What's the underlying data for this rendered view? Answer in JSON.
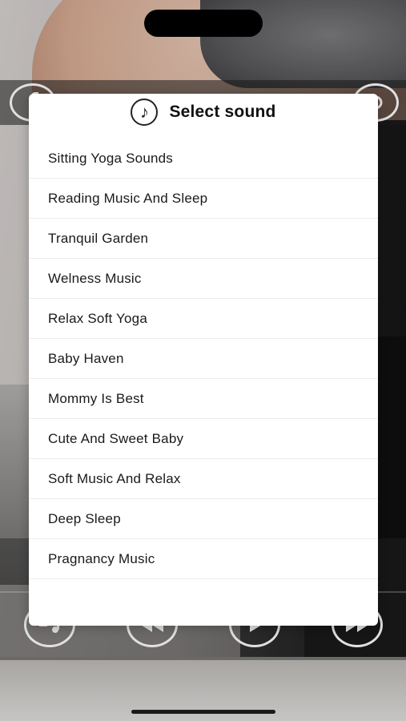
{
  "dialog": {
    "title": "Select sound",
    "icon": "music-note-icon",
    "items": [
      {
        "label": "Sitting Yoga Sounds"
      },
      {
        "label": "Reading Music And Sleep"
      },
      {
        "label": "Tranquil Garden"
      },
      {
        "label": "Welness Music"
      },
      {
        "label": "Relax Soft Yoga"
      },
      {
        "label": "Baby Haven"
      },
      {
        "label": "Mommy Is Best"
      },
      {
        "label": "Cute And Sweet Baby"
      },
      {
        "label": "Soft Music And Relax"
      },
      {
        "label": "Deep Sleep"
      },
      {
        "label": "Pragnancy Music"
      }
    ]
  },
  "background_controls": {
    "top_left_icon": "facebook-icon",
    "top_right_icon": "settings-icon",
    "bottom_icons": [
      "playlist-icon",
      "rewind-icon",
      "play-icon",
      "fast-forward-icon"
    ]
  }
}
